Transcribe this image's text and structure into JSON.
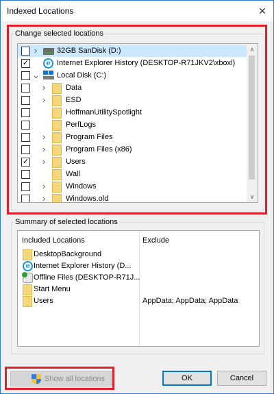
{
  "window": {
    "title": "Indexed Locations",
    "close_glyph": "✕"
  },
  "change_group": {
    "label": "Change selected locations",
    "items": [
      {
        "label": "32GB SanDisk (D:)",
        "checked": false,
        "expander": "collapsed",
        "icon": "usb-drive-icon",
        "indent": 0,
        "selected": true
      },
      {
        "label": "Internet Explorer History (DESKTOP-R71JKV2\\xboxl)",
        "checked": true,
        "expander": "none",
        "icon": "internet-explorer-icon",
        "indent": 0,
        "selected": false
      },
      {
        "label": "Local Disk (C:)",
        "checked": false,
        "expander": "expanded",
        "icon": "windows-disk-icon",
        "indent": 0,
        "selected": false
      },
      {
        "label": "Data",
        "checked": false,
        "expander": "collapsed",
        "icon": "folder-icon",
        "indent": 1,
        "selected": false
      },
      {
        "label": "ESD",
        "checked": false,
        "expander": "collapsed",
        "icon": "folder-icon",
        "indent": 1,
        "selected": false
      },
      {
        "label": "HoffmanUtilitySpotlight",
        "checked": false,
        "expander": "none",
        "icon": "folder-icon",
        "indent": 1,
        "selected": false
      },
      {
        "label": "PerfLogs",
        "checked": false,
        "expander": "none",
        "icon": "folder-icon",
        "indent": 1,
        "selected": false
      },
      {
        "label": "Program Files",
        "checked": false,
        "expander": "collapsed",
        "icon": "folder-icon",
        "indent": 1,
        "selected": false
      },
      {
        "label": "Program Files (x86)",
        "checked": false,
        "expander": "collapsed",
        "icon": "folder-icon",
        "indent": 1,
        "selected": false
      },
      {
        "label": "Users",
        "checked": true,
        "expander": "collapsed",
        "icon": "folder-icon",
        "indent": 1,
        "selected": false
      },
      {
        "label": "Wall",
        "checked": false,
        "expander": "none",
        "icon": "folder-icon",
        "indent": 1,
        "selected": false
      },
      {
        "label": "Windows",
        "checked": false,
        "expander": "collapsed",
        "icon": "folder-icon",
        "indent": 1,
        "selected": false
      },
      {
        "label": "Windows.old",
        "checked": false,
        "expander": "collapsed",
        "icon": "folder-icon",
        "indent": 1,
        "selected": false
      }
    ],
    "scroll_up_glyph": "∧",
    "scroll_down_glyph": "∨"
  },
  "summary_group": {
    "label": "Summary of selected locations",
    "included_header": "Included Locations",
    "exclude_header": "Exclude",
    "rows": [
      {
        "included": "DesktopBackground",
        "exclude": "",
        "icon": "folder-icon"
      },
      {
        "included": "Internet Explorer History (D...",
        "exclude": "",
        "icon": "internet-explorer-icon"
      },
      {
        "included": "Offline Files (DESKTOP-R71J...",
        "exclude": "",
        "icon": "offline-files-icon"
      },
      {
        "included": "Start Menu",
        "exclude": "",
        "icon": "folder-icon"
      },
      {
        "included": "Users",
        "exclude": "AppData; AppData; AppData",
        "icon": "folder-icon"
      }
    ]
  },
  "buttons": {
    "show_all": "Show all locations",
    "ok": "OK",
    "cancel": "Cancel"
  },
  "colors": {
    "highlight": "#e0202d",
    "selection": "#cce8ff",
    "accent": "#0078d7"
  }
}
